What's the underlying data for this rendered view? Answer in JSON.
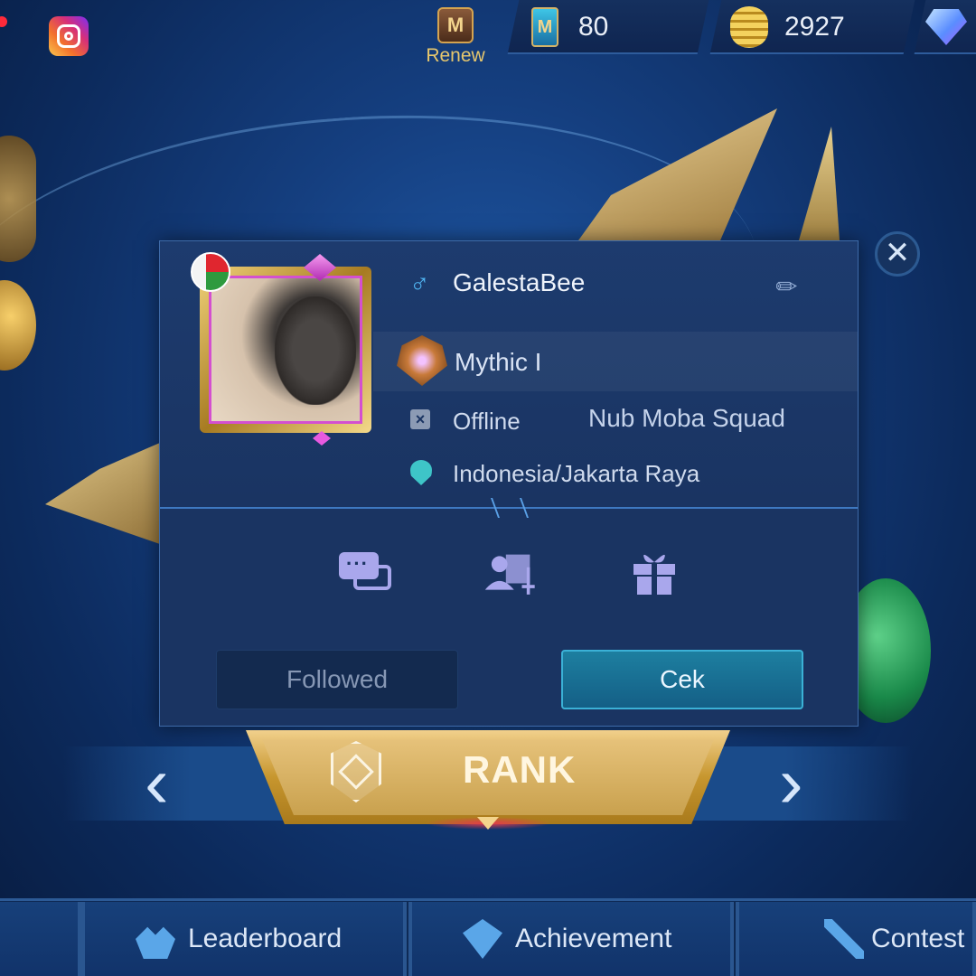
{
  "topbar": {
    "renew_label": "Renew",
    "tickets_value": "80",
    "coins_value": "2927"
  },
  "profile": {
    "username": "GalestaBee",
    "gender_symbol": "♂",
    "rank": "Mythic I",
    "status": "Offline",
    "squad": "Nub Moba Squad",
    "location": "Indonesia/Jakarta Raya",
    "followed_label": "Followed",
    "cek_label": "Cek",
    "close_symbol": "✕"
  },
  "mode": {
    "label": "RANK",
    "left_arrow": "‹",
    "right_arrow": "›"
  },
  "tabs": [
    {
      "label": "Leaderboard"
    },
    {
      "label": "Achievement"
    },
    {
      "label": "Contest"
    }
  ],
  "icons": {
    "instagram": "instagram-icon",
    "ticket": "ticket-icon",
    "coin": "coin-icon",
    "diamond": "diamond-icon",
    "chat": "chat-icon",
    "duel": "duel-icon",
    "gift": "gift-icon",
    "location": "location-pin-icon",
    "edit": "pencil-icon"
  },
  "colors": {
    "accent": "#3bb1d6",
    "gold": "#e7c76d",
    "gender": "#4fb3f0",
    "action_icons": "#a9a7ec"
  }
}
